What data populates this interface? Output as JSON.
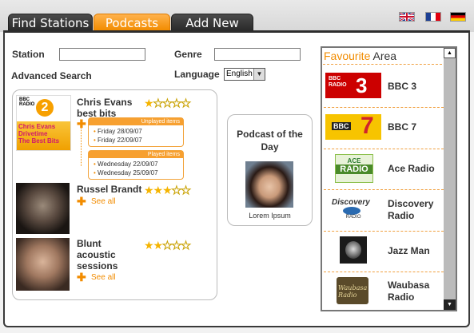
{
  "tabs": [
    {
      "label": "Find Stations"
    },
    {
      "label": "Podcasts"
    },
    {
      "label": "Add New"
    }
  ],
  "languages_flags": [
    "uk-flag-icon",
    "france-flag-icon",
    "germany-flag-icon"
  ],
  "search": {
    "station_label": "Station",
    "station_value": "",
    "genre_label": "Genre",
    "genre_value": "",
    "advanced_label": "Advanced Search",
    "language_label": "Language",
    "language_value": "English"
  },
  "podcasts": [
    {
      "title": "Chris Evans best bits",
      "rating": 1,
      "art_text": "Chris Evans Drivetime The Best Bits",
      "unplayed_label": "Unplayed items",
      "unplayed": [
        "Friday 28/09/07",
        "Friday 22/09/07"
      ],
      "played_label": "Played items",
      "played": [
        "Wednesday 22/09/07",
        "Wednesday 25/09/07"
      ]
    },
    {
      "title": "Russel Brandt",
      "rating": 3,
      "see_all": "See all"
    },
    {
      "title": "Blunt acoustic sessions",
      "rating": 2,
      "see_all": "See all"
    }
  ],
  "podcast_of_day": {
    "title": "Podcast of the Day",
    "caption": "Lorem Ipsum"
  },
  "favourites": {
    "title_accent": "Favourite",
    "title_rest": " Area",
    "items": [
      {
        "name": "BBC 3",
        "logo": "BBC RADIO 3"
      },
      {
        "name": "BBC 7",
        "logo": "BBC 7"
      },
      {
        "name": "Ace Radio",
        "logo": "ACE RADIO"
      },
      {
        "name": "Discovery Radio",
        "logo": "Discovery RADIO"
      },
      {
        "name": "Jazz Man",
        "logo": "jazz"
      },
      {
        "name": "Waubasa Radio",
        "logo": "Waubasa Radio"
      }
    ]
  },
  "colors": {
    "accent": "#f28c00",
    "tab_dark": "#3a3a3a"
  }
}
